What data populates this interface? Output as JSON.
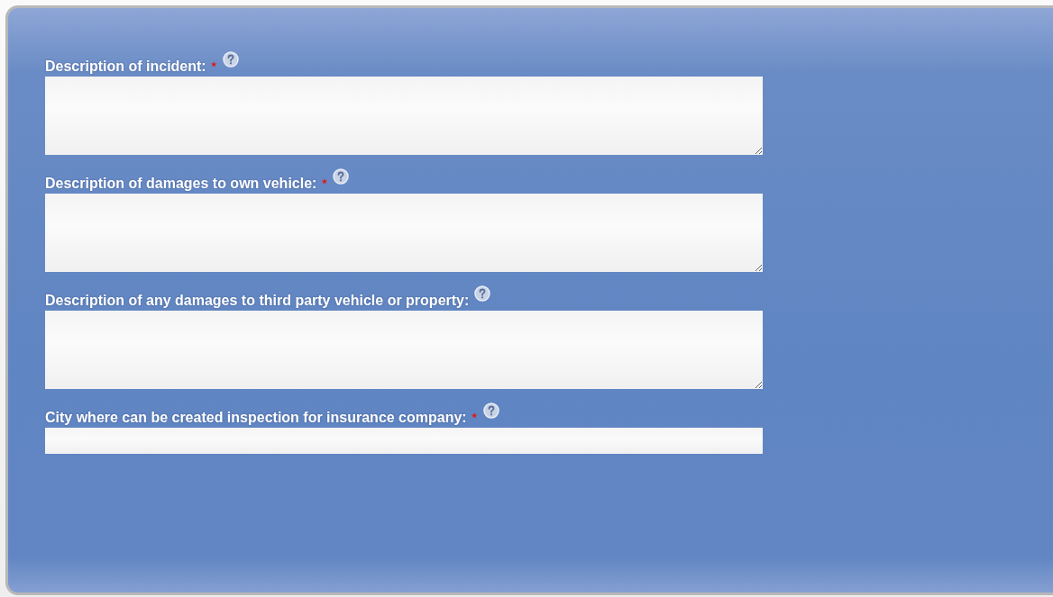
{
  "fields": [
    {
      "label": "Description of incident:",
      "required": true,
      "help": true,
      "kind": "textarea"
    },
    {
      "label": "Description of damages to own vehicle:",
      "required": true,
      "help": true,
      "kind": "textarea"
    },
    {
      "label": "Description of any damages to third party vehicle or property:",
      "required": false,
      "help": true,
      "kind": "textarea"
    },
    {
      "label": "City where can be created inspection for insurance company:",
      "required": true,
      "help": true,
      "kind": "input"
    }
  ]
}
